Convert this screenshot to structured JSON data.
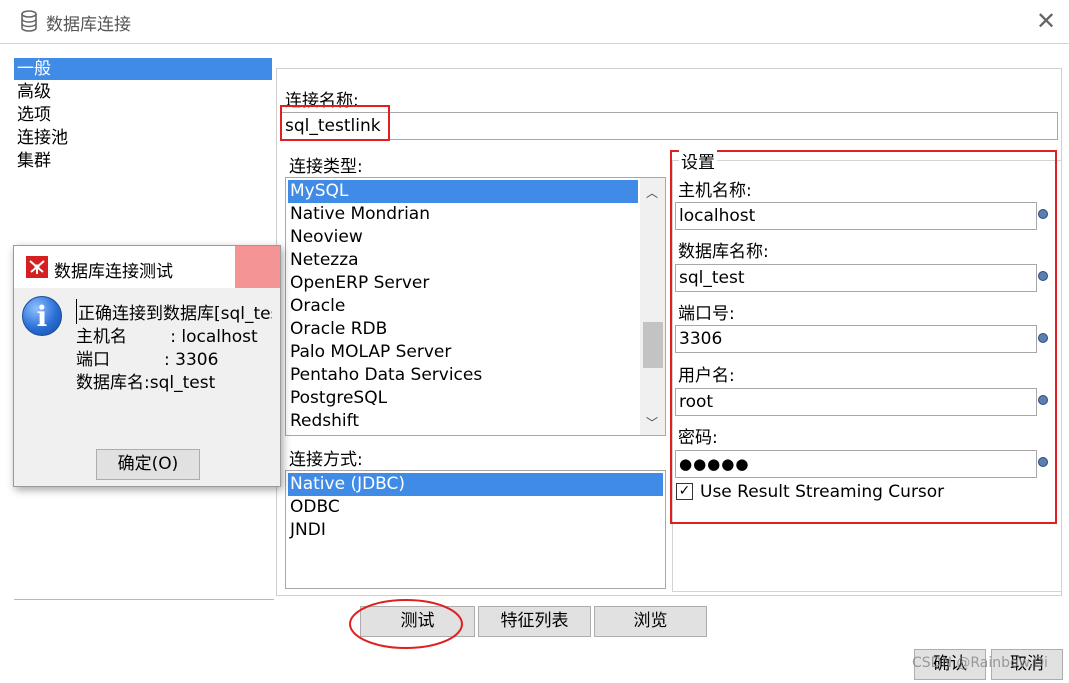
{
  "window": {
    "title": "数据库连接"
  },
  "nav": {
    "items": [
      "一般",
      "高级",
      "选项",
      "连接池",
      "集群"
    ]
  },
  "connection_name": {
    "label": "连接名称:",
    "value": "sql_testlink"
  },
  "connection_type": {
    "label": "连接类型:",
    "items": [
      "MySQL",
      "Native Mondrian",
      "Neoview",
      "Netezza",
      "OpenERP Server",
      "Oracle",
      "Oracle RDB",
      "Palo MOLAP Server",
      "Pentaho Data Services",
      "PostgreSQL",
      "Redshift"
    ],
    "selected": "MySQL"
  },
  "access": {
    "label": "连接方式:",
    "items": [
      "Native (JDBC)",
      "ODBC",
      "JNDI"
    ],
    "selected": "Native (JDBC)"
  },
  "settings": {
    "title": "设置",
    "host_label": "主机名称:",
    "host": "localhost",
    "db_label": "数据库名称:",
    "db": "sql_test",
    "port_label": "端口号:",
    "port": "3306",
    "user_label": "用户名:",
    "user": "root",
    "password_label": "密码:",
    "password": "●●●●●",
    "streaming_label": "Use Result Streaming Cursor",
    "streaming_checked": true
  },
  "buttons": {
    "test": "测试",
    "features": "特征列表",
    "browse": "浏览",
    "ok": "确认",
    "cancel": "取消"
  },
  "popup": {
    "title": "数据库连接测试",
    "line1": "正确连接到数据库[sql_tes",
    "line2": "主机名        : localhost",
    "line3": "端口          : 3306",
    "line4": "数据库名:sql_test",
    "ok": "确定(O)"
  },
  "watermark": "CSDN @Rainbow.Di"
}
